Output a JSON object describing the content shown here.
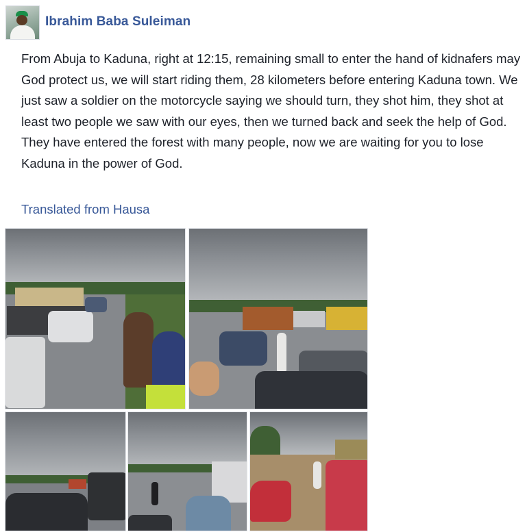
{
  "post": {
    "author": {
      "name": "Ibrahim Baba Suleiman",
      "avatar_icon": "profile-photo"
    },
    "paragraphs": [
      "From Abuja to Kaduna, right at 12:15, remaining small to enter the hand of kidnafers may God protect us, we will start riding them, 28 kilometers before entering Kaduna town. We just saw a soldier on the motorcycle saying we should turn, they shot him, they shot at least two people we saw with our eyes, then we turned back and seek the help of God.",
      "They have entered the forest with many people, now we are waiting for you to lose Kaduna in the power of God."
    ],
    "translation_link": "Translated from Hausa"
  },
  "colors": {
    "link": "#385898",
    "text": "#1d2129",
    "background": "#ffffff"
  }
}
